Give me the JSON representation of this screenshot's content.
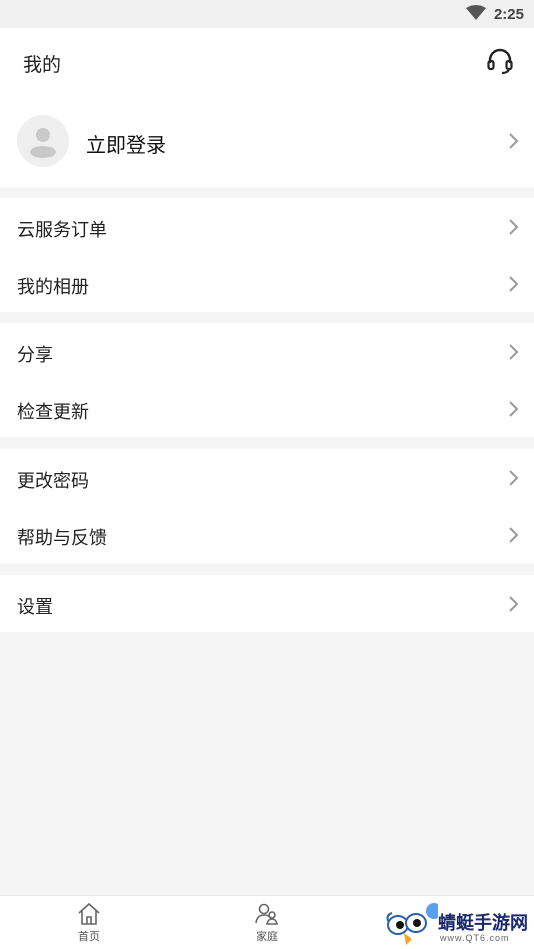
{
  "status_bar": {
    "time": "2:25"
  },
  "header": {
    "title": "我的"
  },
  "login": {
    "label": "立即登录"
  },
  "groups": [
    {
      "items": [
        {
          "label": "云服务订单"
        },
        {
          "label": "我的相册"
        }
      ]
    },
    {
      "items": [
        {
          "label": "分享"
        },
        {
          "label": "检查更新"
        }
      ]
    },
    {
      "items": [
        {
          "label": "更改密码"
        },
        {
          "label": "帮助与反馈"
        }
      ]
    },
    {
      "items": [
        {
          "label": "设置"
        }
      ]
    }
  ],
  "bottom_nav": {
    "items": [
      {
        "label": "首页",
        "icon": "home-icon"
      },
      {
        "label": "家庭",
        "icon": "family-icon"
      }
    ]
  },
  "watermark": {
    "text": "蜻蜓手游网",
    "sub": "www.QT6.com"
  },
  "colors": {
    "background": "#f5f5f5",
    "card": "#ffffff",
    "text": "#222222",
    "chevron": "#9a9a9a"
  }
}
